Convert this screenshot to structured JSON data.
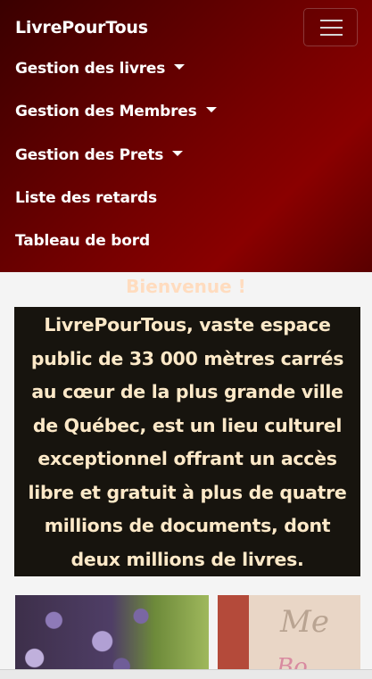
{
  "navbar": {
    "brand": "LivrePourTous",
    "items": [
      {
        "label": "Gestion des livres",
        "dropdown": true
      },
      {
        "label": "Gestion des Membres",
        "dropdown": true
      },
      {
        "label": "Gestion des Prets",
        "dropdown": true
      },
      {
        "label": "Liste des retards",
        "dropdown": false
      },
      {
        "label": "Tableau de bord",
        "dropdown": false
      }
    ]
  },
  "main": {
    "welcome": "Bienvenue !",
    "intro": "LivrePourTous, vaste espace public de 33 000 mètres carrés au cœur de la plus grande ville de Québec, est un lieu culturel exceptionnel offrant un accès libre et gratuit à plus de quatre millions de documents, dont deux millions de livres.",
    "cards": [
      {
        "image": "flowers-photo"
      },
      {
        "image": "books-poster",
        "visible_text": "Me",
        "visible_text_2": "Bo"
      }
    ]
  },
  "colors": {
    "navbar_dark": "#3a0000",
    "navbar_red": "#8a0000",
    "welcome_text": "#ffdcbf",
    "intro_bg": "#17140e",
    "intro_text": "#fde9c8"
  }
}
